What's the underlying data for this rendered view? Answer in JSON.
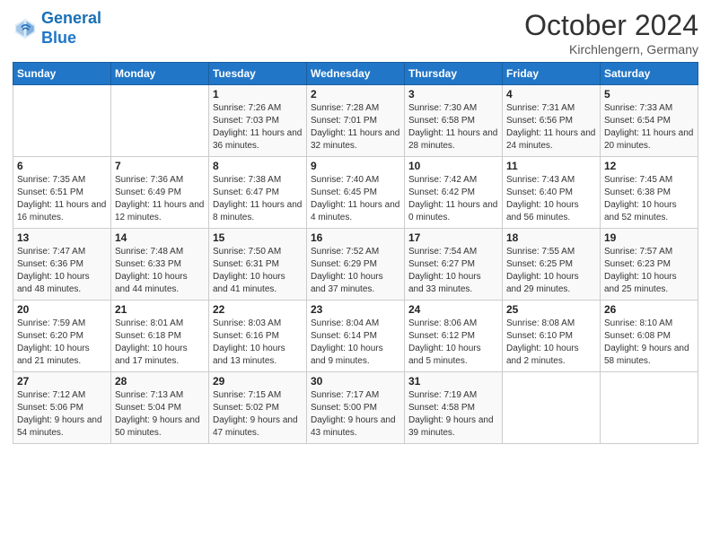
{
  "logo": {
    "line1": "General",
    "line2": "Blue"
  },
  "title": "October 2024",
  "location": "Kirchlengern, Germany",
  "days_header": [
    "Sunday",
    "Monday",
    "Tuesday",
    "Wednesday",
    "Thursday",
    "Friday",
    "Saturday"
  ],
  "weeks": [
    [
      {
        "day": "",
        "sunrise": "",
        "sunset": "",
        "daylight": ""
      },
      {
        "day": "",
        "sunrise": "",
        "sunset": "",
        "daylight": ""
      },
      {
        "day": "1",
        "sunrise": "Sunrise: 7:26 AM",
        "sunset": "Sunset: 7:03 PM",
        "daylight": "Daylight: 11 hours and 36 minutes."
      },
      {
        "day": "2",
        "sunrise": "Sunrise: 7:28 AM",
        "sunset": "Sunset: 7:01 PM",
        "daylight": "Daylight: 11 hours and 32 minutes."
      },
      {
        "day": "3",
        "sunrise": "Sunrise: 7:30 AM",
        "sunset": "Sunset: 6:58 PM",
        "daylight": "Daylight: 11 hours and 28 minutes."
      },
      {
        "day": "4",
        "sunrise": "Sunrise: 7:31 AM",
        "sunset": "Sunset: 6:56 PM",
        "daylight": "Daylight: 11 hours and 24 minutes."
      },
      {
        "day": "5",
        "sunrise": "Sunrise: 7:33 AM",
        "sunset": "Sunset: 6:54 PM",
        "daylight": "Daylight: 11 hours and 20 minutes."
      }
    ],
    [
      {
        "day": "6",
        "sunrise": "Sunrise: 7:35 AM",
        "sunset": "Sunset: 6:51 PM",
        "daylight": "Daylight: 11 hours and 16 minutes."
      },
      {
        "day": "7",
        "sunrise": "Sunrise: 7:36 AM",
        "sunset": "Sunset: 6:49 PM",
        "daylight": "Daylight: 11 hours and 12 minutes."
      },
      {
        "day": "8",
        "sunrise": "Sunrise: 7:38 AM",
        "sunset": "Sunset: 6:47 PM",
        "daylight": "Daylight: 11 hours and 8 minutes."
      },
      {
        "day": "9",
        "sunrise": "Sunrise: 7:40 AM",
        "sunset": "Sunset: 6:45 PM",
        "daylight": "Daylight: 11 hours and 4 minutes."
      },
      {
        "day": "10",
        "sunrise": "Sunrise: 7:42 AM",
        "sunset": "Sunset: 6:42 PM",
        "daylight": "Daylight: 11 hours and 0 minutes."
      },
      {
        "day": "11",
        "sunrise": "Sunrise: 7:43 AM",
        "sunset": "Sunset: 6:40 PM",
        "daylight": "Daylight: 10 hours and 56 minutes."
      },
      {
        "day": "12",
        "sunrise": "Sunrise: 7:45 AM",
        "sunset": "Sunset: 6:38 PM",
        "daylight": "Daylight: 10 hours and 52 minutes."
      }
    ],
    [
      {
        "day": "13",
        "sunrise": "Sunrise: 7:47 AM",
        "sunset": "Sunset: 6:36 PM",
        "daylight": "Daylight: 10 hours and 48 minutes."
      },
      {
        "day": "14",
        "sunrise": "Sunrise: 7:48 AM",
        "sunset": "Sunset: 6:33 PM",
        "daylight": "Daylight: 10 hours and 44 minutes."
      },
      {
        "day": "15",
        "sunrise": "Sunrise: 7:50 AM",
        "sunset": "Sunset: 6:31 PM",
        "daylight": "Daylight: 10 hours and 41 minutes."
      },
      {
        "day": "16",
        "sunrise": "Sunrise: 7:52 AM",
        "sunset": "Sunset: 6:29 PM",
        "daylight": "Daylight: 10 hours and 37 minutes."
      },
      {
        "day": "17",
        "sunrise": "Sunrise: 7:54 AM",
        "sunset": "Sunset: 6:27 PM",
        "daylight": "Daylight: 10 hours and 33 minutes."
      },
      {
        "day": "18",
        "sunrise": "Sunrise: 7:55 AM",
        "sunset": "Sunset: 6:25 PM",
        "daylight": "Daylight: 10 hours and 29 minutes."
      },
      {
        "day": "19",
        "sunrise": "Sunrise: 7:57 AM",
        "sunset": "Sunset: 6:23 PM",
        "daylight": "Daylight: 10 hours and 25 minutes."
      }
    ],
    [
      {
        "day": "20",
        "sunrise": "Sunrise: 7:59 AM",
        "sunset": "Sunset: 6:20 PM",
        "daylight": "Daylight: 10 hours and 21 minutes."
      },
      {
        "day": "21",
        "sunrise": "Sunrise: 8:01 AM",
        "sunset": "Sunset: 6:18 PM",
        "daylight": "Daylight: 10 hours and 17 minutes."
      },
      {
        "day": "22",
        "sunrise": "Sunrise: 8:03 AM",
        "sunset": "Sunset: 6:16 PM",
        "daylight": "Daylight: 10 hours and 13 minutes."
      },
      {
        "day": "23",
        "sunrise": "Sunrise: 8:04 AM",
        "sunset": "Sunset: 6:14 PM",
        "daylight": "Daylight: 10 hours and 9 minutes."
      },
      {
        "day": "24",
        "sunrise": "Sunrise: 8:06 AM",
        "sunset": "Sunset: 6:12 PM",
        "daylight": "Daylight: 10 hours and 5 minutes."
      },
      {
        "day": "25",
        "sunrise": "Sunrise: 8:08 AM",
        "sunset": "Sunset: 6:10 PM",
        "daylight": "Daylight: 10 hours and 2 minutes."
      },
      {
        "day": "26",
        "sunrise": "Sunrise: 8:10 AM",
        "sunset": "Sunset: 6:08 PM",
        "daylight": "Daylight: 9 hours and 58 minutes."
      }
    ],
    [
      {
        "day": "27",
        "sunrise": "Sunrise: 7:12 AM",
        "sunset": "Sunset: 5:06 PM",
        "daylight": "Daylight: 9 hours and 54 minutes."
      },
      {
        "day": "28",
        "sunrise": "Sunrise: 7:13 AM",
        "sunset": "Sunset: 5:04 PM",
        "daylight": "Daylight: 9 hours and 50 minutes."
      },
      {
        "day": "29",
        "sunrise": "Sunrise: 7:15 AM",
        "sunset": "Sunset: 5:02 PM",
        "daylight": "Daylight: 9 hours and 47 minutes."
      },
      {
        "day": "30",
        "sunrise": "Sunrise: 7:17 AM",
        "sunset": "Sunset: 5:00 PM",
        "daylight": "Daylight: 9 hours and 43 minutes."
      },
      {
        "day": "31",
        "sunrise": "Sunrise: 7:19 AM",
        "sunset": "Sunset: 4:58 PM",
        "daylight": "Daylight: 9 hours and 39 minutes."
      },
      {
        "day": "",
        "sunrise": "",
        "sunset": "",
        "daylight": ""
      },
      {
        "day": "",
        "sunrise": "",
        "sunset": "",
        "daylight": ""
      }
    ]
  ]
}
